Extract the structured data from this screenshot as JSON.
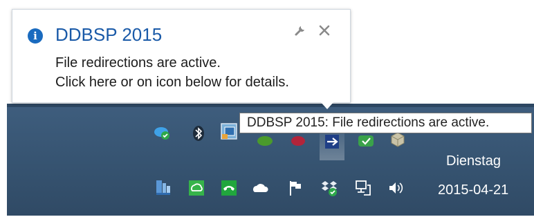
{
  "balloon": {
    "title": "DDBSP 2015",
    "message_line1": "File redirections are active.",
    "message_line2": "Click here or on icon below for details.",
    "icon": "info-icon",
    "actions": [
      "wrench-icon",
      "close-icon"
    ]
  },
  "tooltip": {
    "text": "DDBSP 2015: File redirections are active."
  },
  "tray": {
    "upper_row_icons": [
      "onedrive-sync-icon",
      "bluetooth-icon",
      "screenshot-tool-icon",
      "green-app-icon",
      "red-app-icon",
      "ddbsp-icon",
      "shield-check-icon",
      "package-icon"
    ],
    "lower_row_icons": [
      "book-app-icon",
      "cloud-sync-icon",
      "phone-icon",
      "onedrive-icon",
      "action-center-flag-icon",
      "dropbox-icon",
      "network-icon",
      "volume-icon"
    ]
  },
  "clock": {
    "day": "Dienstag",
    "date": "2015-04-21"
  },
  "colors": {
    "taskbar": "#3e5d7d",
    "balloon_title": "#1a5aa8",
    "info_icon": "#1a6bbf"
  }
}
